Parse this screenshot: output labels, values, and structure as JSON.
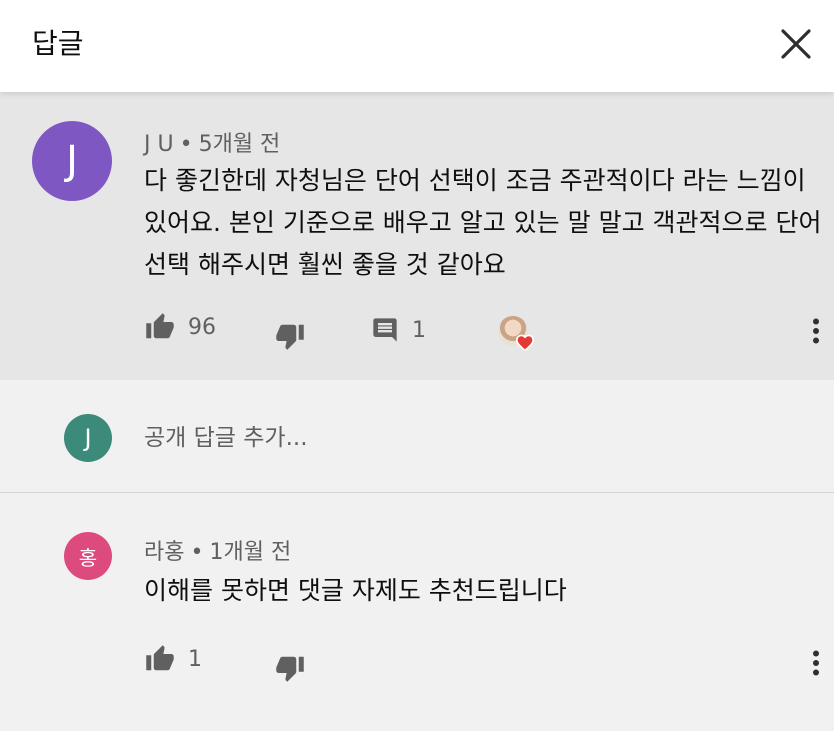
{
  "header": {
    "title": "답글",
    "close_icon": "close-icon"
  },
  "parent_comment": {
    "avatar_letter": "J",
    "avatar_color": "#7e57c2",
    "author": "J U",
    "separator": "•",
    "time": "5개월 전",
    "text": "다 좋긴한데 자청님은 단어 선택이 조금 주관적이다 라는 느낌이 있어요. 본인 기준으로 배우고 알고 있는 말 말고 객관적으로 단어 선택 해주시면 훨씬 좋을 것 같아요",
    "likes": "96",
    "replies": "1",
    "heart_color": "#e53935"
  },
  "reply_box": {
    "avatar_letter": "J",
    "avatar_color": "#3b8a7a",
    "placeholder": "공개 답글 추가..."
  },
  "child_comment": {
    "avatar_letter": "홍",
    "avatar_color": "#dd4b7e",
    "author": "라홍",
    "separator": "•",
    "time": "1개월 전",
    "text": "이해를 못하면 댓글 자제도 추천드립니다",
    "likes": "1"
  }
}
